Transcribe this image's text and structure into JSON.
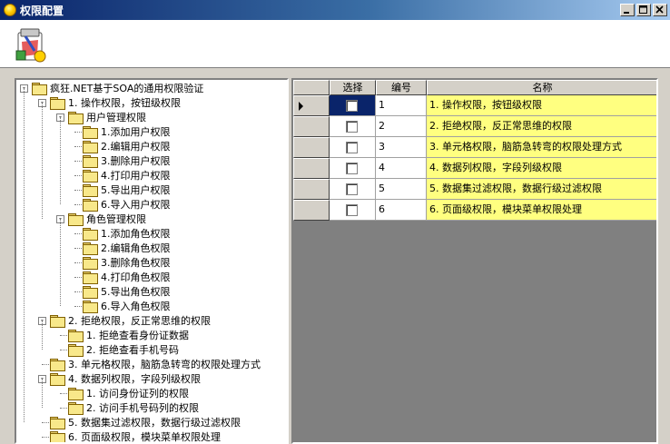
{
  "window": {
    "title": "权限配置"
  },
  "tree": [
    {
      "label": "疯狂.NET基于SOA的通用权限验证",
      "level": 0,
      "expander": "-"
    },
    {
      "label": "1. 操作权限，按钮级权限",
      "level": 1,
      "expander": "-"
    },
    {
      "label": "用户管理权限",
      "level": 2,
      "expander": "-"
    },
    {
      "label": "1.添加用户权限",
      "level": 3,
      "expander": ""
    },
    {
      "label": "2.编辑用户权限",
      "level": 3,
      "expander": ""
    },
    {
      "label": "3.删除用户权限",
      "level": 3,
      "expander": ""
    },
    {
      "label": "4.打印用户权限",
      "level": 3,
      "expander": ""
    },
    {
      "label": "5.导出用户权限",
      "level": 3,
      "expander": ""
    },
    {
      "label": "6.导入用户权限",
      "level": 3,
      "expander": ""
    },
    {
      "label": "角色管理权限",
      "level": 2,
      "expander": "-"
    },
    {
      "label": "1.添加角色权限",
      "level": 3,
      "expander": ""
    },
    {
      "label": "2.编辑角色权限",
      "level": 3,
      "expander": ""
    },
    {
      "label": "3.删除角色权限",
      "level": 3,
      "expander": ""
    },
    {
      "label": "4.打印角色权限",
      "level": 3,
      "expander": ""
    },
    {
      "label": "5.导出角色权限",
      "level": 3,
      "expander": ""
    },
    {
      "label": "6.导入角色权限",
      "level": 3,
      "expander": ""
    },
    {
      "label": "2. 拒绝权限，反正常思维的权限",
      "level": 1,
      "expander": "-"
    },
    {
      "label": "1. 拒绝查看身份证数据",
      "level": 2,
      "expander": ""
    },
    {
      "label": "2. 拒绝查看手机号码",
      "level": 2,
      "expander": ""
    },
    {
      "label": "3. 单元格权限，脑筋急转弯的权限处理方式",
      "level": 1,
      "expander": ""
    },
    {
      "label": "4. 数据列权限，字段列级权限",
      "level": 1,
      "expander": "-"
    },
    {
      "label": "1. 访问身份证列的权限",
      "level": 2,
      "expander": ""
    },
    {
      "label": "2. 访问手机号码列的权限",
      "level": 2,
      "expander": ""
    },
    {
      "label": "5. 数据集过滤权限，数据行级过滤权限",
      "level": 1,
      "expander": ""
    },
    {
      "label": "6. 页面级权限，模块菜单权限处理",
      "level": 1,
      "expander": ""
    }
  ],
  "grid": {
    "headers": {
      "select": "选择",
      "code": "编号",
      "name": "名称"
    },
    "rows": [
      {
        "code": "1",
        "name": "1. 操作权限，按钮级权限",
        "checked": false,
        "current": true
      },
      {
        "code": "2",
        "name": "2. 拒绝权限，反正常思维的权限",
        "checked": false,
        "current": false
      },
      {
        "code": "3",
        "name": "3. 单元格权限，脑筋急转弯的权限处理方式",
        "checked": false,
        "current": false
      },
      {
        "code": "4",
        "name": "4. 数据列权限，字段列级权限",
        "checked": false,
        "current": false
      },
      {
        "code": "5",
        "name": "5. 数据集过滤权限，数据行级过滤权限",
        "checked": false,
        "current": false
      },
      {
        "code": "6",
        "name": "6. 页面级权限，模块菜单权限处理",
        "checked": false,
        "current": false
      }
    ]
  }
}
